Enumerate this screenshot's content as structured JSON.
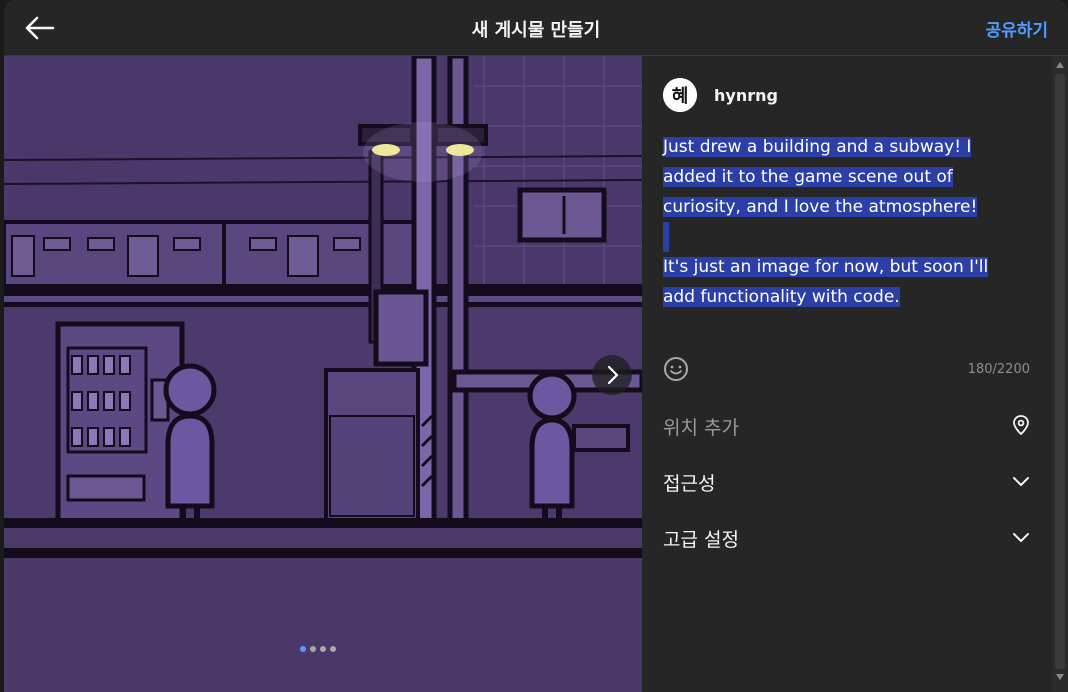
{
  "header": {
    "title": "새 게시물 만들기",
    "share_label": "공유하기",
    "back_icon": "arrow-left-icon"
  },
  "post": {
    "username": "hynrng",
    "avatar_text": "혜",
    "caption_lines": [
      "Just drew a building and a subway! I",
      "added it to the game scene out of",
      "curiosity, and I love the atmosphere!",
      "",
      "It's just an image for now, but soon I'll",
      "add functionality with code."
    ],
    "char_count": "180/2200",
    "emoji_icon": "smiley-icon"
  },
  "settings": {
    "location_placeholder": "위치 추가",
    "location_icon": "map-pin-icon",
    "accessibility_label": "접근성",
    "advanced_label": "고급 설정",
    "chevron_icon": "chevron-down-icon"
  },
  "carousel": {
    "total_slides": 4,
    "active_slide": 1,
    "next_icon": "chevron-right-icon"
  },
  "colors": {
    "accent": "#4f9eff",
    "highlight": "#2c3fa6",
    "panel": "#262626",
    "artwork_bg": "#4b3968"
  }
}
